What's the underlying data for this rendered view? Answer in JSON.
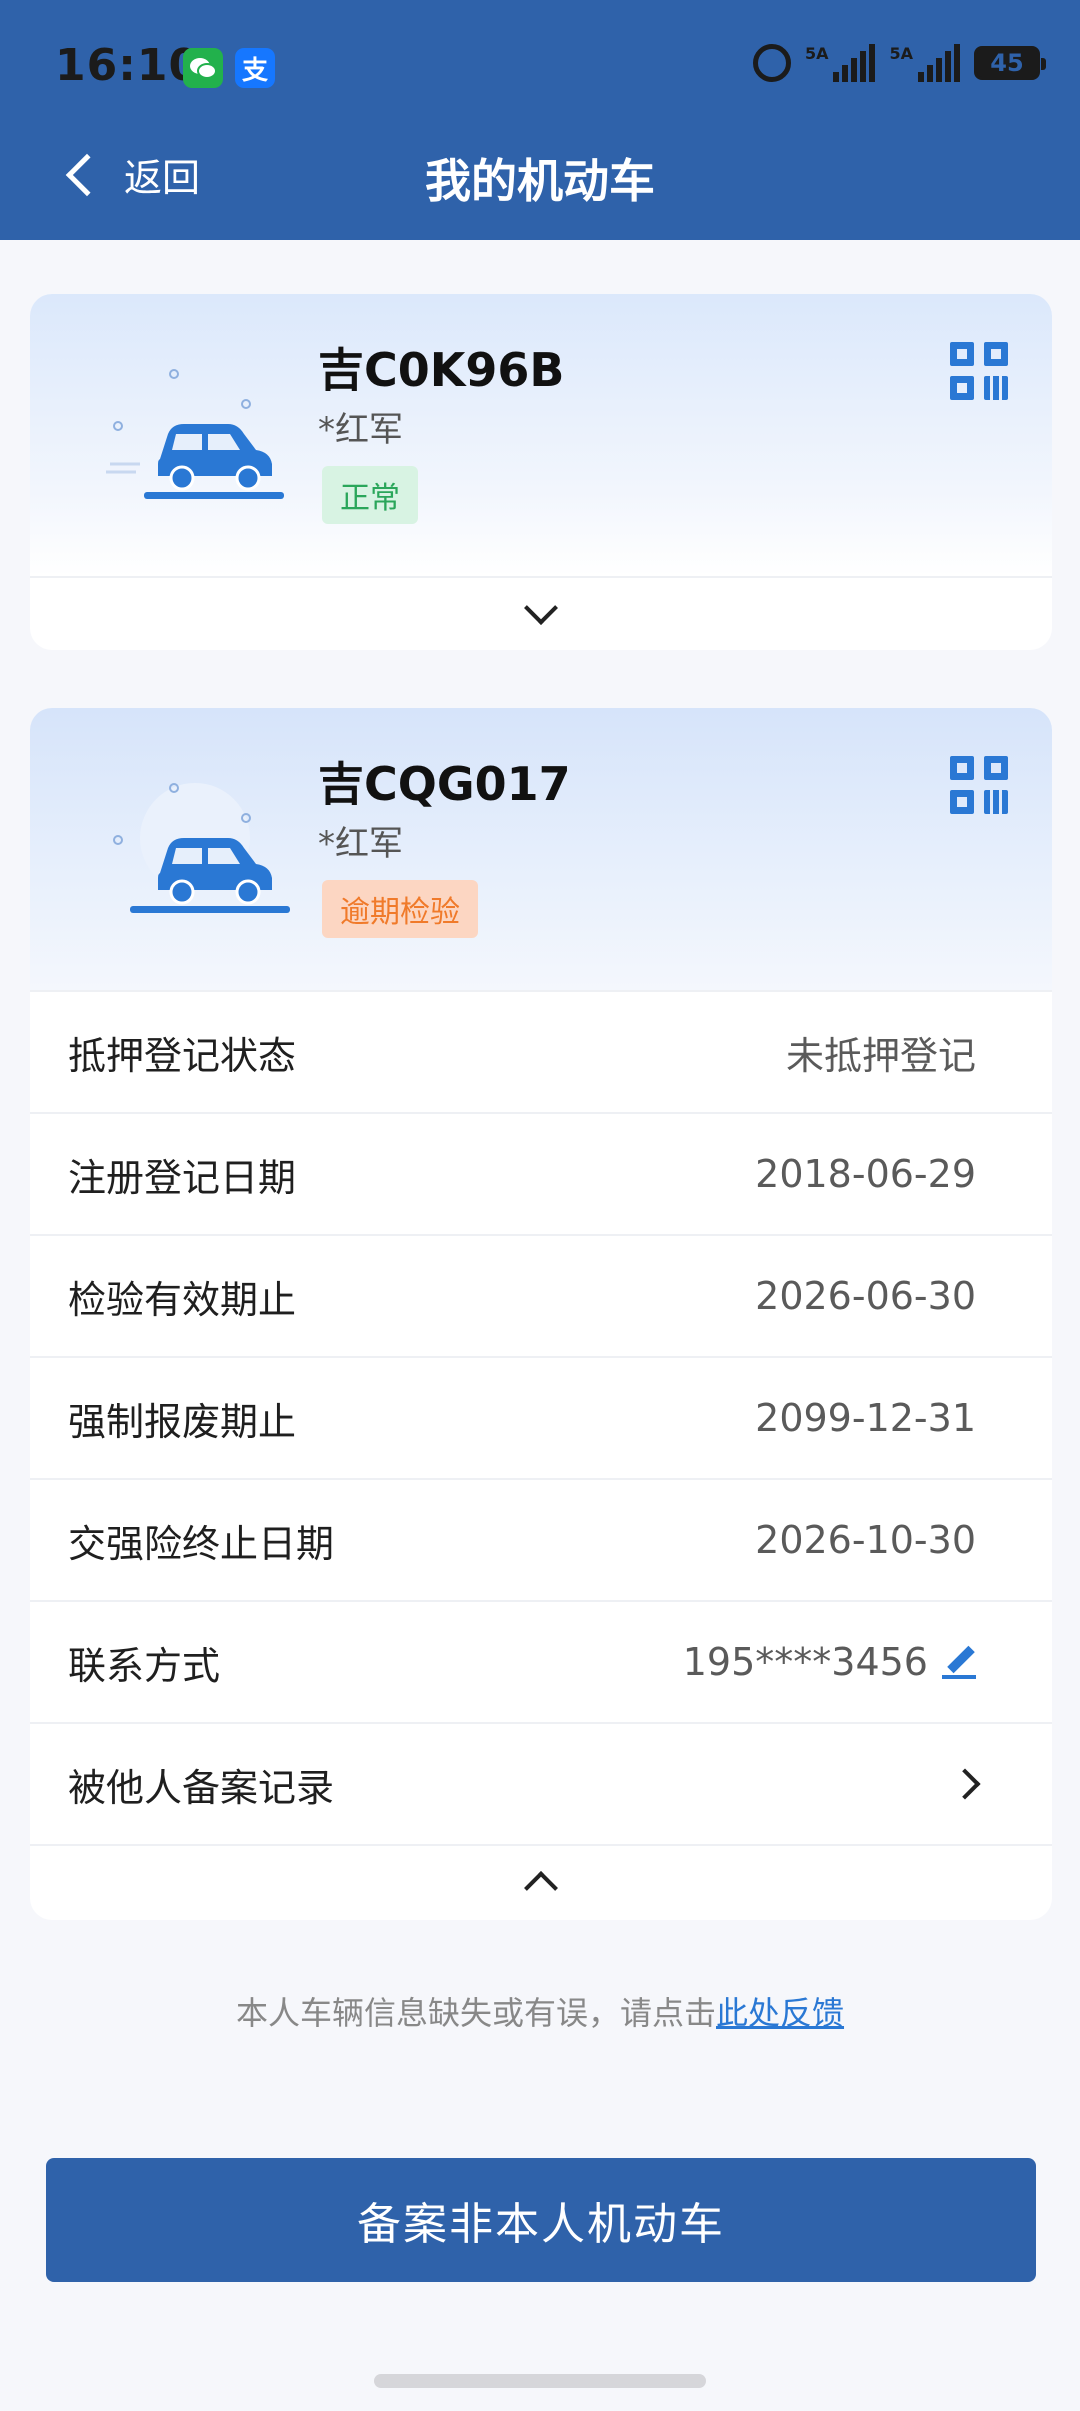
{
  "status_bar": {
    "time": "16:10",
    "wechat_icon": "wechat-icon",
    "alipay_icon": "alipay-icon",
    "alipay_glyph": "支",
    "signal1_label": "5A",
    "signal2_label": "5A",
    "battery": "45"
  },
  "nav": {
    "back_label": "返回",
    "title": "我的机动车"
  },
  "vehicles": [
    {
      "plate": "吉C0K96B",
      "owner": "*红军",
      "status": "正常",
      "status_color": "#2aa65a",
      "expanded": false
    },
    {
      "plate": "吉CQG017",
      "owner": "*红军",
      "status": "逾期检验",
      "status_color": "#f07a2a",
      "expanded": true,
      "details": [
        {
          "label": "抵押登记状态",
          "value": "未抵押登记"
        },
        {
          "label": "注册登记日期",
          "value": "2018-06-29"
        },
        {
          "label": "检验有效期止",
          "value": "2026-06-30"
        },
        {
          "label": "强制报废期止",
          "value": "2099-12-31"
        },
        {
          "label": "交强险终止日期",
          "value": "2026-10-30"
        },
        {
          "label": "联系方式",
          "value": "195****3456"
        },
        {
          "label": "被他人备案记录",
          "value": ""
        }
      ]
    }
  ],
  "feedback": {
    "text": "本人车辆信息缺失或有误，请点击",
    "link": "此处反馈"
  },
  "bottom_button": "备案非本人机动车",
  "colors": {
    "primary": "#2f62aa",
    "accent": "#2a78d4",
    "ok": "#2aa65a",
    "warn": "#f07a2a"
  }
}
